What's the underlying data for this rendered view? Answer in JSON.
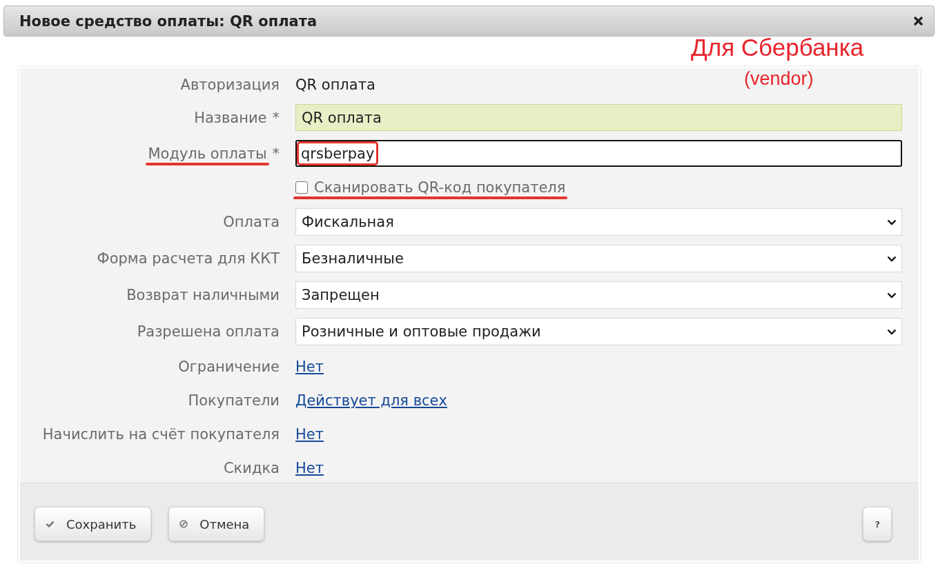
{
  "dialog": {
    "title": "Новое средство оплаты: QR оплата"
  },
  "annotation": {
    "title": "Для Сбербанка",
    "note": "(vendor)"
  },
  "rows": [
    {
      "kind": "text",
      "label": "Авторизация",
      "value": "QR оплата"
    },
    {
      "kind": "input",
      "label": "Название",
      "required_mark": "*",
      "value": "QR оплата",
      "highlighted": true,
      "focused": false
    },
    {
      "kind": "input",
      "label": "Модуль оплаты",
      "required_mark": "*",
      "value": "qrsberpay",
      "highlighted": false,
      "focused": true,
      "label_marked": true,
      "value_marked": true
    },
    {
      "kind": "checkbox",
      "label": "Сканировать QR-код покупателя",
      "checked": false,
      "marked": true
    },
    {
      "kind": "select",
      "label": "Оплата",
      "value": "Фискальная"
    },
    {
      "kind": "select",
      "label": "Форма расчета для ККТ",
      "value": "Безналичные"
    },
    {
      "kind": "select",
      "label": "Возврат наличными",
      "value": "Запрещен"
    },
    {
      "kind": "select",
      "label": "Разрешена оплата",
      "value": "Розничные и оптовые продажи"
    },
    {
      "kind": "link",
      "label": "Ограничение",
      "value": "Нет"
    },
    {
      "kind": "link",
      "label": "Покупатели",
      "value": "Действует для всех"
    },
    {
      "kind": "link",
      "label": "Начислить на счёт покупателя",
      "value": "Нет"
    },
    {
      "kind": "link",
      "label": "Скидка",
      "value": "Нет"
    }
  ],
  "buttons": [
    {
      "kind": "save",
      "label": "Сохранить"
    },
    {
      "kind": "cancel",
      "label": "Отмена"
    },
    {
      "kind": "help",
      "label": "?"
    }
  ]
}
